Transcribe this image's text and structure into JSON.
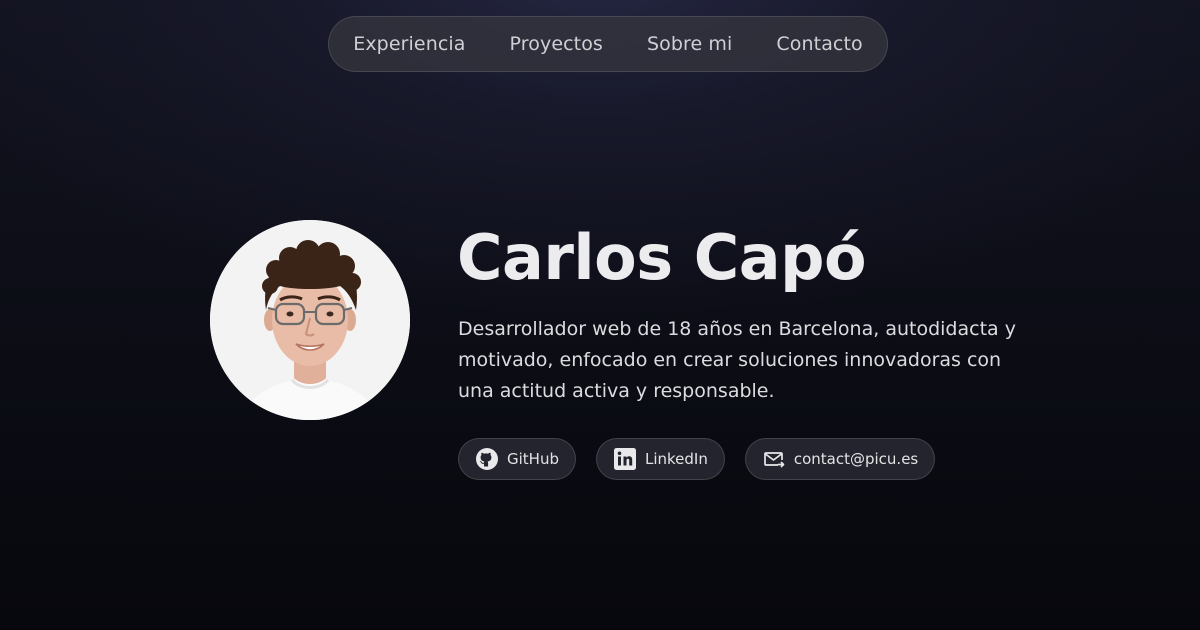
{
  "nav": {
    "items": [
      {
        "label": "Experiencia"
      },
      {
        "label": "Proyectos"
      },
      {
        "label": "Sobre mi"
      },
      {
        "label": "Contacto"
      }
    ]
  },
  "profile": {
    "name": "Carlos Capó",
    "bio": "Desarrollador web de 18 años en Barcelona, autodidacta y motivado, enfocado en crear soluciones innovadoras con una actitud activa y responsable.",
    "avatar_icon": "profile-photo"
  },
  "links": [
    {
      "label": "GitHub",
      "icon": "github-icon"
    },
    {
      "label": "LinkedIn",
      "icon": "linkedin-icon"
    },
    {
      "label": "contact@picu.es",
      "icon": "mail-icon"
    }
  ],
  "colors": {
    "background": "#0b0c14",
    "nav_bg": "#34353e",
    "text": "#ececee",
    "pill_bg": "#23242d"
  }
}
